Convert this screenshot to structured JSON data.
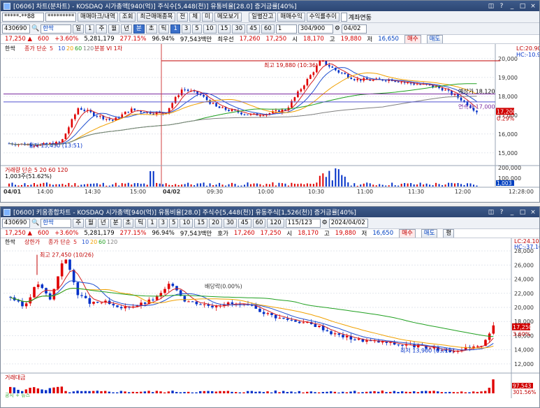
{
  "top": {
    "title": "[0606] 차트(분차트) - KOSDAQ 시가총액[940(억)] 주식수[5,448(천)] 유통비율[28.0] 증거금률[40%]",
    "toolbar": {
      "account": "*****-**88",
      "password": "*********",
      "buttons": [
        "매매마크/내역",
        "조회",
        "최근매매종목",
        "전",
        "체",
        "미",
        "메모보기",
        "일별잔고",
        "매매수익",
        "수익률추이"
      ],
      "checkbox": "계좌연동"
    },
    "toolbar2": {
      "code": "430690",
      "name": "한싹",
      "periods": [
        "일",
        "1",
        "주",
        "월",
        "년",
        "분",
        "초",
        "틱",
        "1",
        "3",
        "5",
        "10",
        "15",
        "30",
        "45",
        "60"
      ],
      "count": "1",
      "range": "304/900",
      "date": "04/02"
    },
    "info": {
      "price": "17,250 ▲",
      "change": "600",
      "pct": "+3.60%",
      "volume": "5,281,179",
      "vol_pct": "277.15%",
      "ratio": "96.94%",
      "amount": "97,543백만",
      "bid_ask": "최우선",
      "bid": "17,260",
      "ask": "17,250",
      "open_label": "시",
      "open": "18,170",
      "high_label": "고",
      "high": "19,880",
      "low_label": "저",
      "low": "16,650",
      "btn_buy": "매수",
      "btn_sell": "매도"
    },
    "legend": [
      "한싹",
      "종가 단순",
      "5",
      "10",
      "20",
      "60",
      "120",
      "분봉 VI 1차"
    ],
    "annotations": {
      "high": "최고 19,880 (10:36)",
      "low": "최저 15,430 (13:51)",
      "vi": "분봉 VI 1차",
      "vi_price": "예상가 18,120",
      "vi_price2": "연속가 17,000",
      "lc": "LC:20.90",
      "hc": "HC:-10.97"
    },
    "vol_legend": "거래량 단순 5 20 60 120",
    "vol_value": "1,003주(51.62%)",
    "vol_badge": "1,003",
    "vol_badge2": "51.62%",
    "price_ticks": [
      "20,000",
      "19,000",
      "18,000",
      "17,000",
      "16,000",
      "15,000"
    ],
    "vol_ticks": [
      "200,000",
      "100,000"
    ],
    "x_labels": [
      "04/01",
      "14:00",
      "14:30",
      "15:00",
      "04/02",
      "09:30",
      "10:00",
      "10:30",
      "11:00",
      "11:30",
      "12:00",
      "12:28:00"
    ],
    "current_price": "17,200",
    "pct_badge": "0.29%"
  },
  "bottom": {
    "title": "[0600] 키움종합차트 - KOSDAQ 시가총액[940(억)] 유통비율[28.0] 주식수[5,448(천)] 유동주식[1,526(천)] 증거금률[40%]",
    "toolbar": {
      "code": "430690",
      "name": "한싹",
      "periods": [
        "주",
        "월",
        "년",
        "분",
        "초",
        "틱",
        "1",
        "3",
        "5",
        "10",
        "15",
        "20",
        "30",
        "45",
        "60",
        "120"
      ],
      "range": "115/123",
      "date": "2024/04/02"
    },
    "info": {
      "price": "17,250 ▲",
      "change": "600",
      "pct": "+3.60%",
      "volume": "5,281,179",
      "vol_pct": "277.15%",
      "ratio": "96.94%",
      "amount": "97,543백만",
      "hoga": "호가",
      "bid": "17,260",
      "ask": "17,250",
      "open_label": "시",
      "open": "18,170",
      "high_label": "고",
      "high": "19,880",
      "low_label": "저",
      "low": "16,650",
      "btn_buy": "매수",
      "btn_sell": "매도",
      "btn_eval": "평"
    },
    "legend": [
      "한싹",
      "상한가",
      "종가 단순",
      "5",
      "10",
      "20",
      "60",
      "120"
    ],
    "annotations": {
      "high": "최고 27,450 (10/26)",
      "low": "최저 13,900 (03/19)",
      "div": "배당락(0.00%)",
      "lc": "LC:24.10",
      "hc": "HC:-37.16",
      "price_badge": "17,250",
      "pct_badge": "3.60%"
    },
    "vol_legend": "거래대금",
    "vol_badge": "97,543",
    "vol_badge2": "301.56%",
    "news_legend": "공시 + 뉴스",
    "price_ticks": [
      "28,000",
      "26,000",
      "24,000",
      "22,000",
      "20,000",
      "18,000",
      "16,000",
      "14,000",
      "12,000"
    ],
    "x_labels": [
      "2023/10",
      "11",
      "12",
      "2024/01",
      "02",
      "03",
      "04",
      "04/02"
    ]
  },
  "colors": {
    "up": "#e00000",
    "down": "#0030c8",
    "ma5": "#d62020",
    "ma10": "#2050d0",
    "ma20": "#f0a000",
    "ma60": "#20a020",
    "ma120": "#808080",
    "news": "#38a838"
  },
  "chart_data": [
    {
      "type": "line",
      "title": "",
      "series": [
        {
          "name": "한싹",
          "x": [
            "04/01 13:51",
            "04/01 14:30",
            "04/02 09:00",
            "04/02 10:00",
            "04/02 10:36",
            "04/02 11:00",
            "04/02 12:28"
          ],
          "values": [
            15430,
            17400,
            18400,
            17700,
            19880,
            18900,
            17200
          ]
        }
      ],
      "ylim": [
        14400,
        20400
      ]
    },
    {
      "type": "line",
      "title": "",
      "series": [
        {
          "name": "한싹",
          "x": [
            "2023/10",
            "2023/10/26",
            "2023/11",
            "2023/12",
            "2024/01",
            "2024/02",
            "2024/03/19",
            "2024/04/02"
          ],
          "values": [
            22000,
            27450,
            20500,
            21000,
            19200,
            15200,
            13900,
            17250
          ]
        }
      ],
      "ylim": [
        11000,
        29000
      ]
    }
  ]
}
